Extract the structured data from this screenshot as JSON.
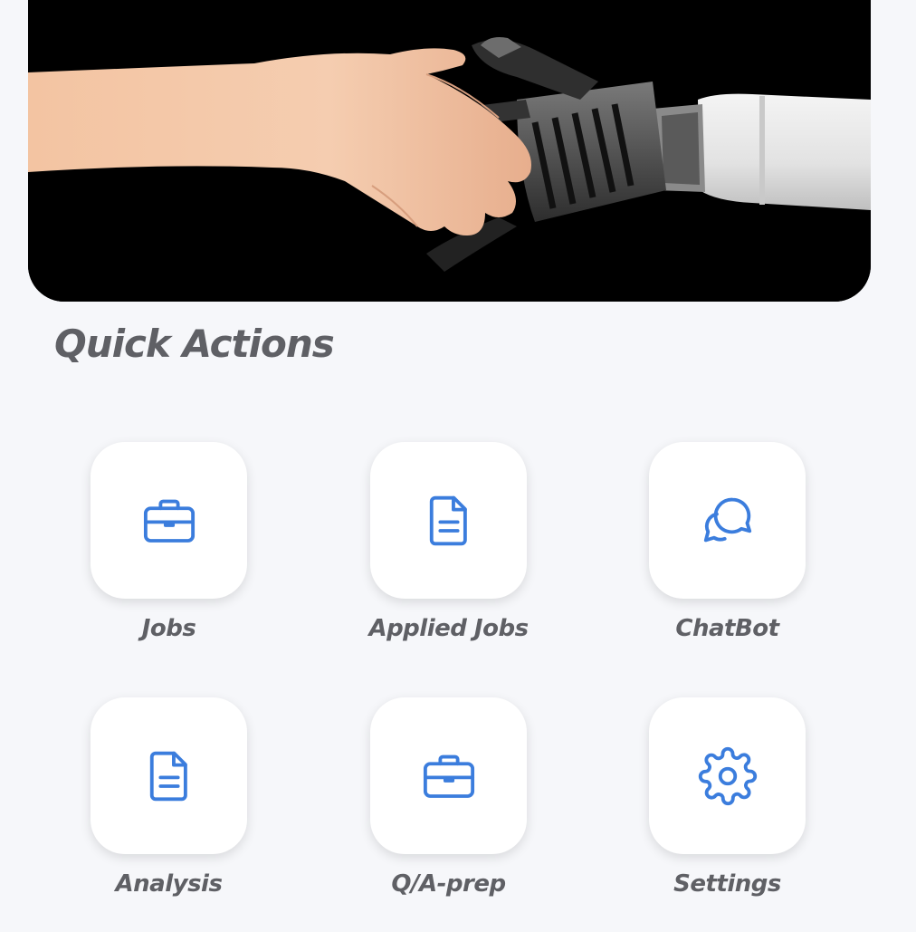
{
  "banner": {
    "image": "handshake-human-robot"
  },
  "quick_actions": {
    "title": "Quick Actions",
    "accent_color": "#3b7ddd",
    "items": [
      {
        "label": "Jobs",
        "icon": "briefcase-icon"
      },
      {
        "label": "Applied Jobs",
        "icon": "document-icon"
      },
      {
        "label": "ChatBot",
        "icon": "chat-bubbles-icon"
      },
      {
        "label": "Analysis",
        "icon": "document-icon"
      },
      {
        "label": "Q/A-prep",
        "icon": "briefcase-icon"
      },
      {
        "label": "Settings",
        "icon": "gear-icon"
      }
    ]
  }
}
